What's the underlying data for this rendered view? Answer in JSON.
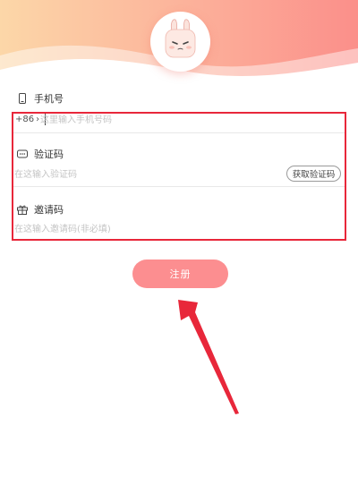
{
  "colors": {
    "accent": "#fc8e90",
    "annotation": "#e8273a",
    "header_gradient_start": "#fcd7a8",
    "header_gradient_end": "#fb8f8a"
  },
  "header": {
    "avatar_icon": "bunny-mascot-icon"
  },
  "form": {
    "phone": {
      "label": "手机号",
      "icon": "phone-icon",
      "prefix": "+86",
      "prefix_chevron": "›",
      "placeholder": "这里输入手机号码",
      "value": ""
    },
    "code": {
      "label": "验证码",
      "icon": "message-dots-icon",
      "placeholder": "在这输入验证码",
      "value": "",
      "get_code_label": "获取验证码"
    },
    "invite": {
      "label": "邀请码",
      "icon": "gift-icon",
      "placeholder": "在这输入邀请码(非必填)",
      "value": ""
    }
  },
  "register_label": "注册"
}
